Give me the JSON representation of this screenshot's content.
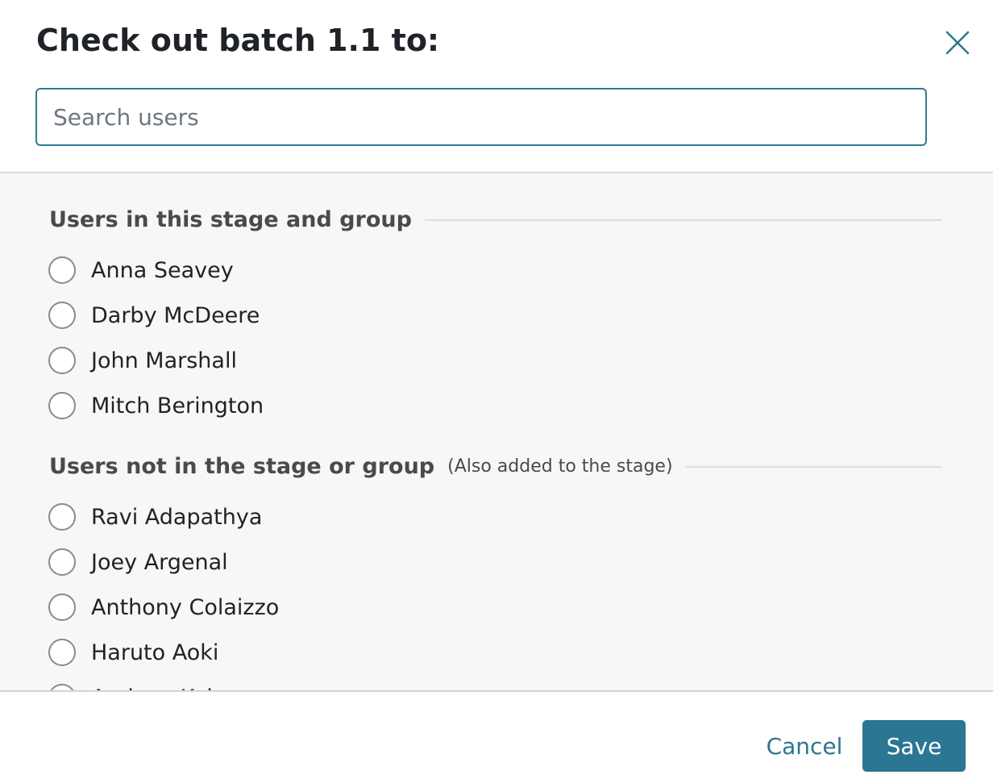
{
  "dialog": {
    "title": "Check out batch 1.1 to:",
    "close_icon": "close-icon"
  },
  "search": {
    "placeholder": "Search users",
    "value": ""
  },
  "sections": [
    {
      "title": "Users in this stage and group",
      "note": "",
      "users": [
        "Anna Seavey",
        "Darby McDeere",
        "John Marshall",
        "Mitch Berington"
      ]
    },
    {
      "title": "Users not in the stage or group",
      "note": "(Also added to the stage)",
      "users": [
        "Ravi Adapathya",
        "Joey Argenal",
        "Anthony Colaizzo",
        "Haruto Aoki",
        "Andrew Koh"
      ]
    }
  ],
  "footer": {
    "cancel_label": "Cancel",
    "save_label": "Save"
  },
  "colors": {
    "accent": "#2b7693",
    "search_border": "#2f7a94",
    "list_background": "#f7f7f7"
  }
}
